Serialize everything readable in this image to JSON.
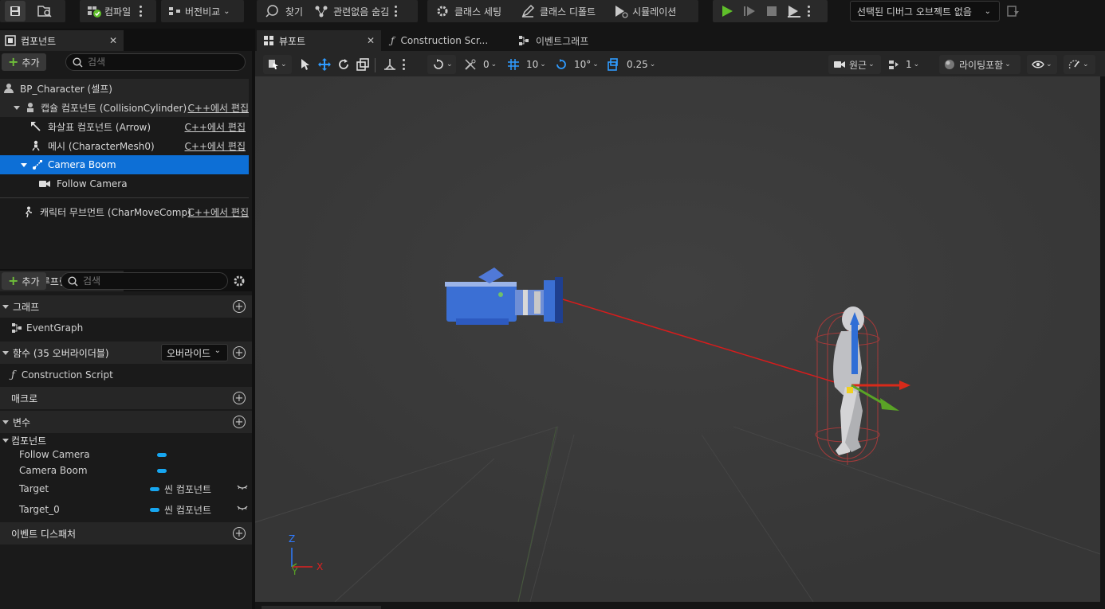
{
  "toolbar": {
    "compile_label": "컴파일",
    "diff_label": "버전비교",
    "find_label": "찾기",
    "hide_unrelated_label": "관련없음 숨김",
    "class_settings_label": "클래스 세팅",
    "class_defaults_label": "클래스 디폴트",
    "simulation_label": "시뮬레이션",
    "debug_object_label": "선택된 디버그 오브젝트 없음"
  },
  "components_panel": {
    "tab_label": "컴포넌트",
    "add_label": "추가",
    "search_placeholder": "검색",
    "tree": [
      {
        "label": "BP_Character (셀프)",
        "link": ""
      },
      {
        "label": "캡슐 컴포넌트 (CollisionCylinder)",
        "link": "C++에서 편집"
      },
      {
        "label": "화살표 컴포넌트 (Arrow)",
        "link": "C++에서 편집"
      },
      {
        "label": "메시 (CharacterMesh0)",
        "link": "C++에서 편집"
      },
      {
        "label": "Camera Boom",
        "link": ""
      },
      {
        "label": "Follow Camera",
        "link": ""
      },
      {
        "label": "캐릭터 무브먼트 (CharMoveComp)",
        "link": "C++에서 편집"
      }
    ]
  },
  "blueprint_panel": {
    "tab_label": "내 블루프린트",
    "add_label": "추가",
    "search_placeholder": "검색",
    "graph_section": "그래프",
    "event_graph": "EventGraph",
    "functions_section": "함수 (35 오버라이더블)",
    "override_label": "오버라이드",
    "construction_script": "Construction Script",
    "macros_section": "매크로",
    "variables_section": "변수",
    "components_category": "컴포넌트",
    "variables": [
      {
        "name": "Follow Camera",
        "type": ""
      },
      {
        "name": "Camera Boom",
        "type": ""
      },
      {
        "name": "Target",
        "type": "씬 컴포넌트"
      },
      {
        "name": "Target_0",
        "type": "씬 컴포넌트"
      }
    ],
    "event_dispatchers_section": "이벤트 디스패처"
  },
  "editor_tabs": {
    "viewport": "뷰포트",
    "construction": "Construction Scr...",
    "event_graph": "이벤트그래프"
  },
  "viewport_toolbar": {
    "rotation_snap": "0",
    "grid_snap": "10",
    "angle_snap": "10°",
    "scale_snap": "0.25",
    "perspective": "원근",
    "camera_speed": "1",
    "lighting": "라이팅포함"
  },
  "axis": {
    "z": "Z",
    "y": "Y",
    "x": "X"
  },
  "colors": {
    "selection": "#0d6fd6",
    "play": "#5fbf2a",
    "accent_blue": "#2f9bff",
    "pill": "#17a6f0"
  }
}
